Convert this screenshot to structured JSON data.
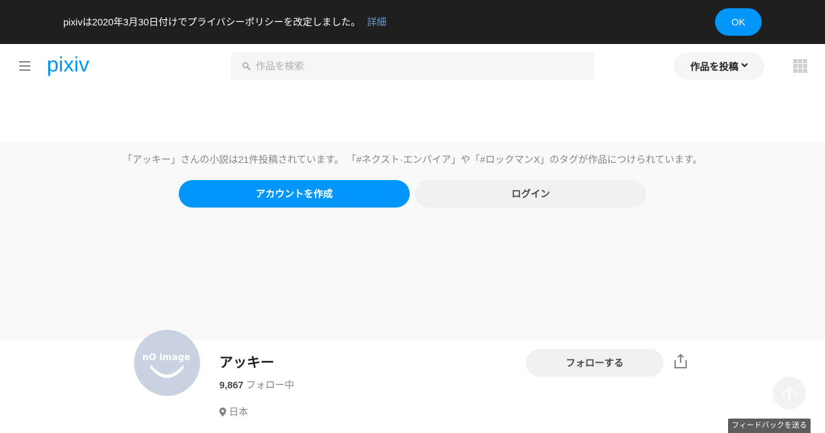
{
  "notice": {
    "message": "pixivは2020年3月30日付けでプライバシーポリシーを改定しました。",
    "link_label": "詳細",
    "ok_label": "OK"
  },
  "header": {
    "menu_icon": "hamburger-icon",
    "logo_text": "pixiv",
    "search": {
      "placeholder": "作品を検索",
      "value": ""
    },
    "post_button_label": "作品を投稿",
    "apps_icon": "grid-icon"
  },
  "hero": {
    "message": "「アッキー」さんの小説は21件投稿されています。 「#ネクスト·エンパイア」や「#ロックマンX」のタグが作品につけられています。",
    "create_account_label": "アカウントを作成",
    "login_label": "ログイン"
  },
  "profile": {
    "avatar_text": "nO image",
    "name": "アッキー",
    "following_count": "9,867",
    "following_label": "フォロー中",
    "location": "日本",
    "follow_button_label": "フォローする"
  },
  "floating": {
    "feedback_label": "フィードバックを送る"
  },
  "colors": {
    "brand_blue": "#0096fa",
    "notice_bg": "#1f1f1f",
    "link": "#6b9bd2",
    "hero_bg": "#f9f9f9"
  }
}
